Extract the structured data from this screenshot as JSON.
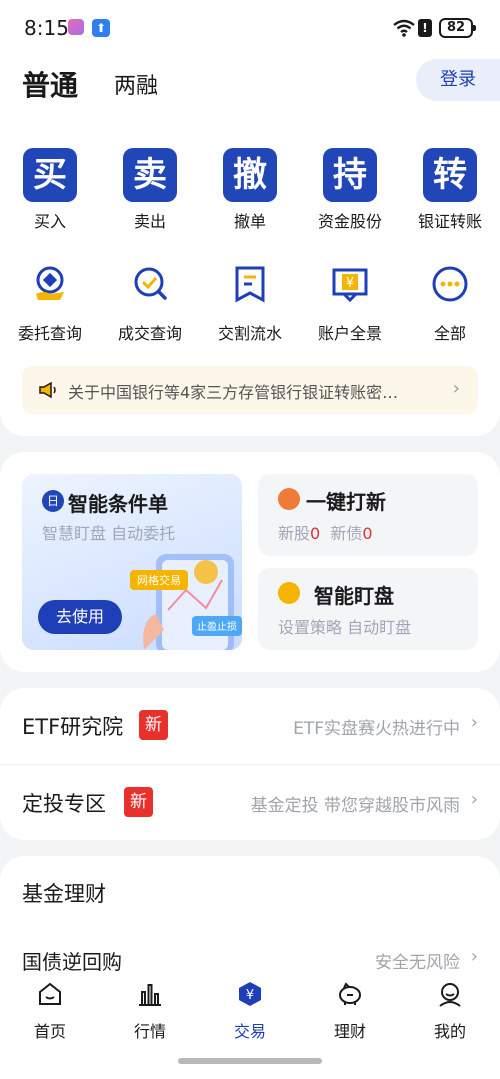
{
  "status": {
    "time": "8:15",
    "battery": "82",
    "alert": "!"
  },
  "header": {
    "tab_normal": "普通",
    "tab_margin": "两融",
    "login": "登录"
  },
  "main_actions": [
    {
      "icon_char": "买",
      "label": "买入"
    },
    {
      "icon_char": "卖",
      "label": "卖出"
    },
    {
      "icon_char": "撤",
      "label": "撤单"
    },
    {
      "icon_char": "持",
      "label": "资金股份"
    },
    {
      "icon_char": "转",
      "label": "银证转账"
    }
  ],
  "sub_actions": [
    {
      "icon": "delegate-query-icon",
      "label": "委托查询"
    },
    {
      "icon": "deal-query-icon",
      "label": "成交查询"
    },
    {
      "icon": "settlement-icon",
      "label": "交割流水"
    },
    {
      "icon": "account-overview-icon",
      "label": "账户全景"
    },
    {
      "icon": "more-icon",
      "label": "全部"
    }
  ],
  "notice": {
    "text": "关于中国银行等4家三方存管银行银证转账密…",
    "chevron": "›"
  },
  "promo": {
    "smart_order": {
      "title": "智能条件单",
      "subtitle": "智慧盯盘 自动委托",
      "button": "去使用",
      "icon_char": "日",
      "tag1": "网格交易",
      "tag2": "止盈止损"
    },
    "ipo": {
      "title": "一键打新",
      "new_stock_label": "新股",
      "new_stock_count": "0",
      "new_bond_label": "新债",
      "new_bond_count": "0"
    },
    "watch": {
      "title": "智能盯盘",
      "subtitle": "设置策略 自动盯盘"
    }
  },
  "list": [
    {
      "title": "ETF研究院",
      "badge": "新",
      "right": "ETF实盘赛火热进行中",
      "chevron": "›"
    },
    {
      "title": "定投专区",
      "badge": "新",
      "right": "基金定投 带您穿越股市风雨",
      "chevron": "›"
    }
  ],
  "fund": {
    "title": "基金理财",
    "repo_title": "国债逆回购",
    "repo_right": "安全无风险",
    "chevron": "›"
  },
  "bottom_nav": [
    {
      "label": "首页"
    },
    {
      "label": "行情"
    },
    {
      "label": "交易"
    },
    {
      "label": "理财"
    },
    {
      "label": "我的"
    }
  ],
  "colors": {
    "accent": "#1f3fb8",
    "badge_red": "#e8302d",
    "notice_bg": "#fdf7ea"
  }
}
